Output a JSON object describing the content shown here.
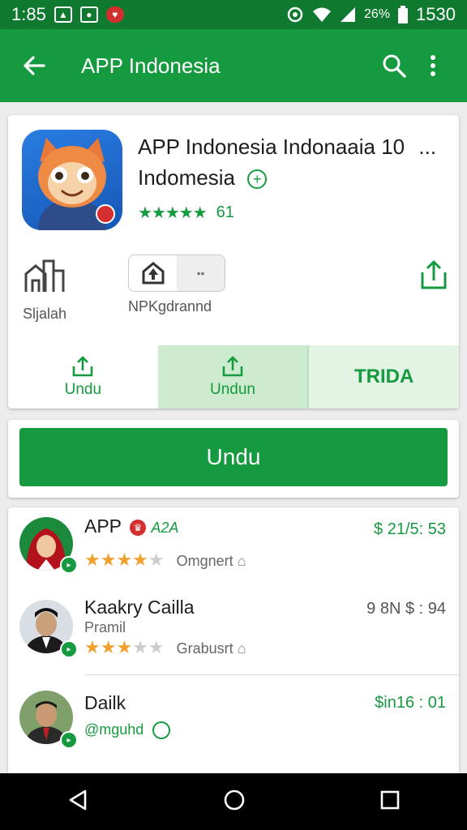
{
  "status_bar": {
    "time": "1:85",
    "battery_text": "26%",
    "clock_right": "1530"
  },
  "app_bar": {
    "title": "APP Indonesia"
  },
  "app": {
    "title_line1": "APP Indonesia Indonaaia  10",
    "title_more": "...",
    "title_line2": "Indomesia",
    "stars": "★★★★★",
    "rating_count": "61",
    "meta_left_label": "Sljalah",
    "meta_mid_label": "NPKgdrannd",
    "meta_seg_right": "••"
  },
  "actions": [
    {
      "label": "Undu"
    },
    {
      "label": "Undun"
    },
    {
      "label": "TRIDA"
    }
  ],
  "cta": {
    "label": "Undu"
  },
  "list": [
    {
      "name": "APP",
      "tag": "A2A",
      "price": "$ 21/5: 53",
      "rating": 4,
      "meta": "Omgnert"
    },
    {
      "name": "Kaakry Cailla",
      "sub": "Pramil",
      "price": "9 8N $ : 94",
      "rating": 3,
      "meta": "Grabusrt"
    },
    {
      "name": "Dailk",
      "sub": "@mguhd",
      "price": "$in16 : 01"
    }
  ],
  "colors": {
    "status": "#0f7a2f",
    "primary": "#169a3f",
    "star": "#f2a02d"
  }
}
